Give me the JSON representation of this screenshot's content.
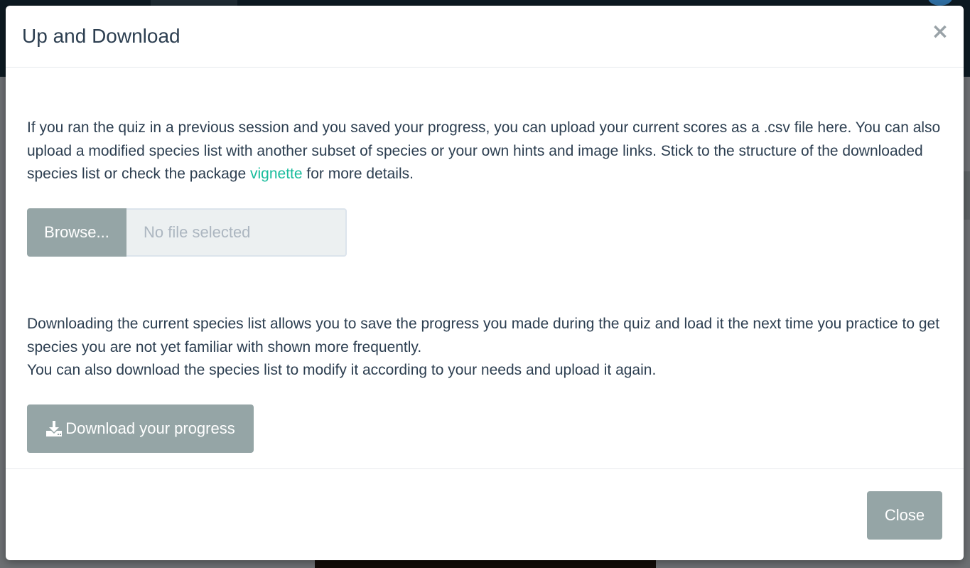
{
  "modal": {
    "title": "Up and Download",
    "close_symbol": "×"
  },
  "upload": {
    "text_before_link": "If you ran the quiz in a previous session and you saved your progress, you can upload your current scores as a .csv file here. You can also upload a modified species list with another subset of species or your own hints and image links. Stick to the structure of the downloaded species list or check the package ",
    "link_text": "vignette",
    "text_after_link": " for more details.",
    "browse_label": "Browse...",
    "file_placeholder": "No file selected"
  },
  "download": {
    "text_line1": "Downloading the current species list allows you to save the progress you made during the quiz and load it the next time you practice to get species you are not yet familiar with shown more frequently.",
    "text_line2": "You can also download the species list to modify it according to your needs and upload it again.",
    "button_label": "Download your progress",
    "button_icon": "download-icon"
  },
  "footer": {
    "close_label": "Close"
  },
  "colors": {
    "primary_text": "#2c3e50",
    "link": "#18bc9c",
    "button_bg": "#95a5a6",
    "button_text": "#ffffff",
    "input_bg": "#ecf0f1",
    "placeholder": "#acb6c0"
  }
}
